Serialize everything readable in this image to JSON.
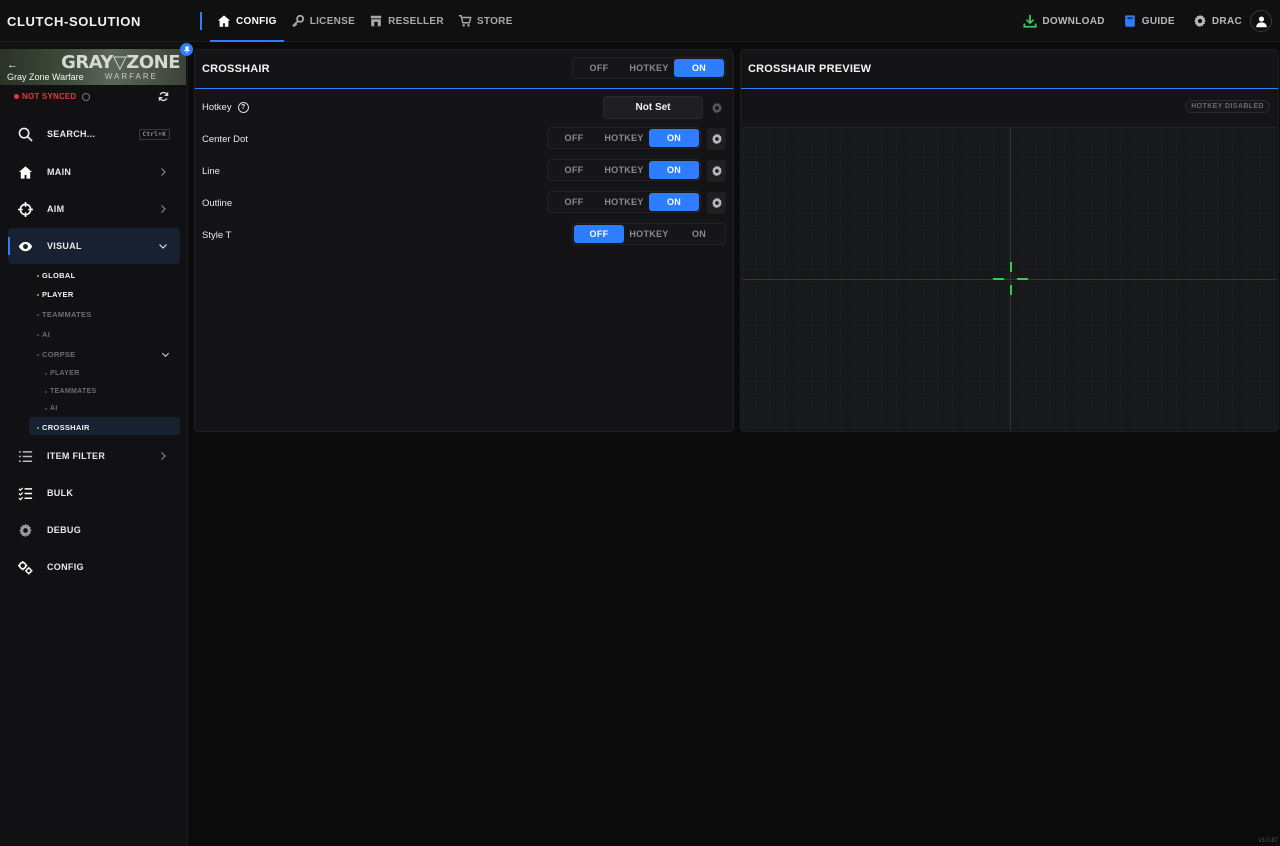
{
  "brand": "CLUTCH-SOLUTION",
  "nav": [
    {
      "label": "CONFIG",
      "icon": "home-icon",
      "active": true
    },
    {
      "label": "LICENSE",
      "icon": "key-icon",
      "active": false
    },
    {
      "label": "RESELLER",
      "icon": "storefront-icon",
      "active": false
    },
    {
      "label": "STORE",
      "icon": "cart-icon",
      "active": false
    }
  ],
  "top_right": {
    "download": "DOWNLOAD",
    "guide": "GUIDE",
    "user": "DRAC"
  },
  "colors": {
    "accent": "#2f7dff",
    "danger": "#e23b3b",
    "ok": "#4cd964",
    "crosshair": "#2fd04a"
  },
  "game": {
    "name": "Gray Zone Warfare",
    "logo": "GRAY▽ZONE",
    "logo_sub": "WARFARE",
    "sync_status": "NOT SYNCED"
  },
  "sidebar": {
    "search_label": "SEARCH...",
    "search_shortcut": "Ctrl+K",
    "items": [
      {
        "label": "MAIN"
      },
      {
        "label": "AIM"
      },
      {
        "label": "VISUAL"
      },
      {
        "label": "ITEM FILTER"
      },
      {
        "label": "BULK"
      },
      {
        "label": "DEBUG"
      },
      {
        "label": "CONFIG"
      }
    ],
    "visual_sub": [
      {
        "label": "GLOBAL",
        "enabled": true
      },
      {
        "label": "PLAYER",
        "enabled": true
      },
      {
        "label": "TEAMMATES",
        "enabled": false
      },
      {
        "label": "AI",
        "enabled": false
      },
      {
        "label": "CORPSE",
        "enabled": false
      },
      {
        "label": "PLAYER",
        "enabled": false
      },
      {
        "label": "TEAMMATES",
        "enabled": false
      },
      {
        "label": "AI",
        "enabled": false
      },
      {
        "label": "CROSSHAIR",
        "enabled": true
      }
    ]
  },
  "crosshair_panel": {
    "title": "CROSSHAIR",
    "master": {
      "options": [
        "OFF",
        "HOTKEY",
        "ON"
      ],
      "selected": "ON"
    },
    "hotkey_label": "Hotkey",
    "hotkey_help": "?",
    "hotkey_value": "Not Set",
    "rows": [
      {
        "label": "Center Dot",
        "options": [
          "OFF",
          "HOTKEY",
          "ON"
        ],
        "selected": "ON"
      },
      {
        "label": "Line",
        "options": [
          "OFF",
          "HOTKEY",
          "ON"
        ],
        "selected": "ON"
      },
      {
        "label": "Outline",
        "options": [
          "OFF",
          "HOTKEY",
          "ON"
        ],
        "selected": "ON"
      },
      {
        "label": "Style T",
        "options": [
          "OFF",
          "HOTKEY",
          "ON"
        ],
        "selected": "OFF"
      }
    ]
  },
  "preview_panel": {
    "title": "CROSSHAIR PREVIEW",
    "hotkey_badge": "HOTKEY DISABLED"
  },
  "version": "v3.0.87"
}
